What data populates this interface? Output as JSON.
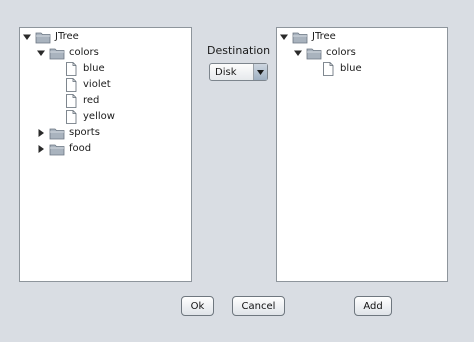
{
  "left_tree": {
    "nodes": [
      {
        "label": "JTree",
        "level": 0,
        "kind": "folder",
        "expanded": true
      },
      {
        "label": "colors",
        "level": 1,
        "kind": "folder",
        "expanded": true
      },
      {
        "label": "blue",
        "level": 2,
        "kind": "leaf"
      },
      {
        "label": "violet",
        "level": 2,
        "kind": "leaf"
      },
      {
        "label": "red",
        "level": 2,
        "kind": "leaf"
      },
      {
        "label": "yellow",
        "level": 2,
        "kind": "leaf"
      },
      {
        "label": "sports",
        "level": 1,
        "kind": "folder",
        "expanded": false
      },
      {
        "label": "food",
        "level": 1,
        "kind": "folder",
        "expanded": false
      }
    ]
  },
  "destination": {
    "label": "Destination",
    "selected": "Disk"
  },
  "right_tree": {
    "nodes": [
      {
        "label": "JTree",
        "level": 0,
        "kind": "folder",
        "expanded": true
      },
      {
        "label": "colors",
        "level": 1,
        "kind": "folder",
        "expanded": true
      },
      {
        "label": "blue",
        "level": 2,
        "kind": "leaf"
      }
    ]
  },
  "buttons": {
    "ok": "Ok",
    "cancel": "Cancel",
    "add": "Add"
  },
  "colors": {
    "background": "#d9dde3",
    "folder": "#a9b3be",
    "panel": "#ffffff"
  }
}
